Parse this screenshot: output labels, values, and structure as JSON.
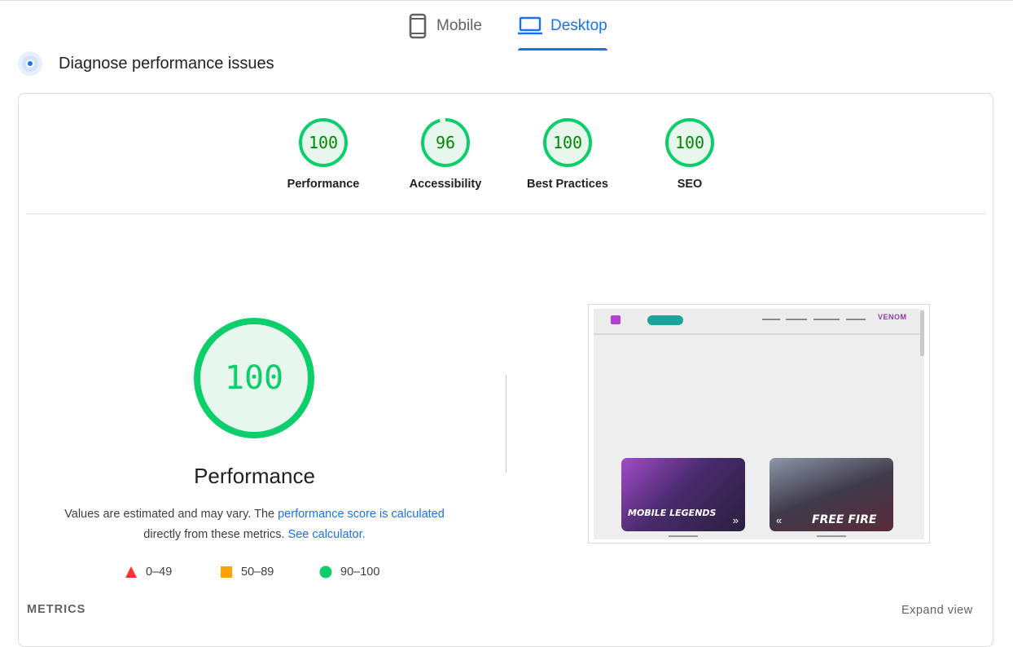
{
  "tabs": [
    {
      "label": "Mobile",
      "icon": "phone-icon",
      "active": false
    },
    {
      "label": "Desktop",
      "icon": "laptop-icon",
      "active": true
    }
  ],
  "section": {
    "title": "Diagnose performance issues",
    "icon": "diagnose-icon"
  },
  "categories": [
    {
      "label": "Performance",
      "score": 100
    },
    {
      "label": "Accessibility",
      "score": 96
    },
    {
      "label": "Best Practices",
      "score": 100
    },
    {
      "label": "SEO",
      "score": 100
    }
  ],
  "performance": {
    "score": 100,
    "title": "Performance",
    "desc_part1": "Values are estimated and may vary. The ",
    "desc_link1": "performance score is calculated",
    "desc_part2": " directly from these metrics. ",
    "desc_link2": "See calculator."
  },
  "legend": [
    {
      "range": "0–49",
      "shape": "triangle",
      "color": "#ff3333"
    },
    {
      "range": "50–89",
      "shape": "square",
      "color": "#ffa400"
    },
    {
      "range": "90–100",
      "shape": "circle",
      "color": "#0cce6b"
    }
  ],
  "screenshot": {
    "logo": "VENOM",
    "game_left": "MOBILE LEGENDS",
    "game_right": "FREE FIRE"
  },
  "metrics": {
    "label": "METRICS",
    "expand": "Expand view"
  },
  "colors": {
    "accent": "#1a73e8",
    "pass": "#0cce6b",
    "pass_text": "#008800",
    "pass_fill": "#e8f7ee"
  }
}
